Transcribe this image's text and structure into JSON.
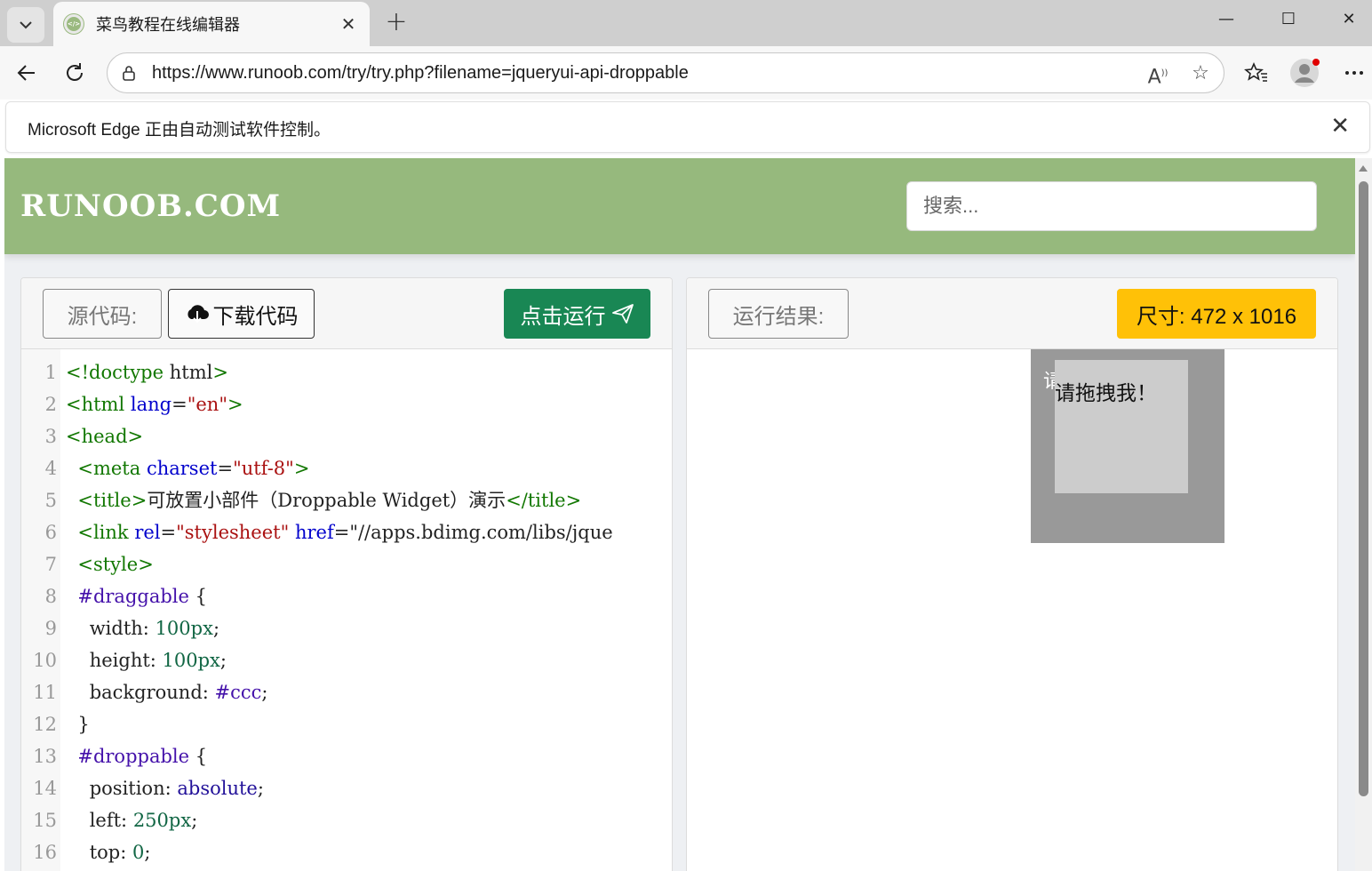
{
  "browser": {
    "tab_title": "菜鸟教程在线编辑器",
    "tab_close": "✕",
    "new_tab": "+",
    "url": "https://www.runoob.com/try/try.php?filename=jqueryui-api-droppable",
    "window_controls": {
      "minimize": "—",
      "maximize": "☐",
      "close": "✕"
    },
    "info_bar_text": "Microsoft Edge 正由自动测试软件控制。",
    "info_bar_close": "✕"
  },
  "site": {
    "logo": "RUNOOB.COM",
    "search_placeholder": "搜索..."
  },
  "editor": {
    "source_label": "源代码:",
    "download_label": "下载代码",
    "run_label": "点击运行",
    "result_label": "运行结果:",
    "size_label": "尺寸: 472 x 1016"
  },
  "code_lines": [
    {
      "n": "1",
      "text": "<!doctype html>"
    },
    {
      "n": "2",
      "text": "<html lang=\"en\">"
    },
    {
      "n": "3",
      "text": "<head>"
    },
    {
      "n": "4",
      "text": "  <meta charset=\"utf-8\">"
    },
    {
      "n": "5",
      "text": "  <title>可放置小部件（Droppable Widget）演示</title>"
    },
    {
      "n": "6",
      "text": "  <link rel=\"stylesheet\" href=\"//apps.bdimg.com/libs/jque"
    },
    {
      "n": "7",
      "text": "  <style>"
    },
    {
      "n": "8",
      "text": "  #draggable {"
    },
    {
      "n": "9",
      "text": "    width: 100px;"
    },
    {
      "n": "10",
      "text": "    height: 100px;"
    },
    {
      "n": "11",
      "text": "    background: #ccc;"
    },
    {
      "n": "12",
      "text": "  }"
    },
    {
      "n": "13",
      "text": "  #droppable {"
    },
    {
      "n": "14",
      "text": "    position: absolute;"
    },
    {
      "n": "15",
      "text": "    left: 250px;"
    },
    {
      "n": "16",
      "text": "    top: 0;"
    }
  ],
  "result": {
    "droppable_text": "请",
    "draggable_text": "请拖拽我！"
  },
  "colors": {
    "header_green": "#96b97d",
    "run_button": "#198754",
    "size_badge": "#ffc107",
    "droppable_bg": "#999999",
    "draggable_bg": "#cccccc"
  }
}
